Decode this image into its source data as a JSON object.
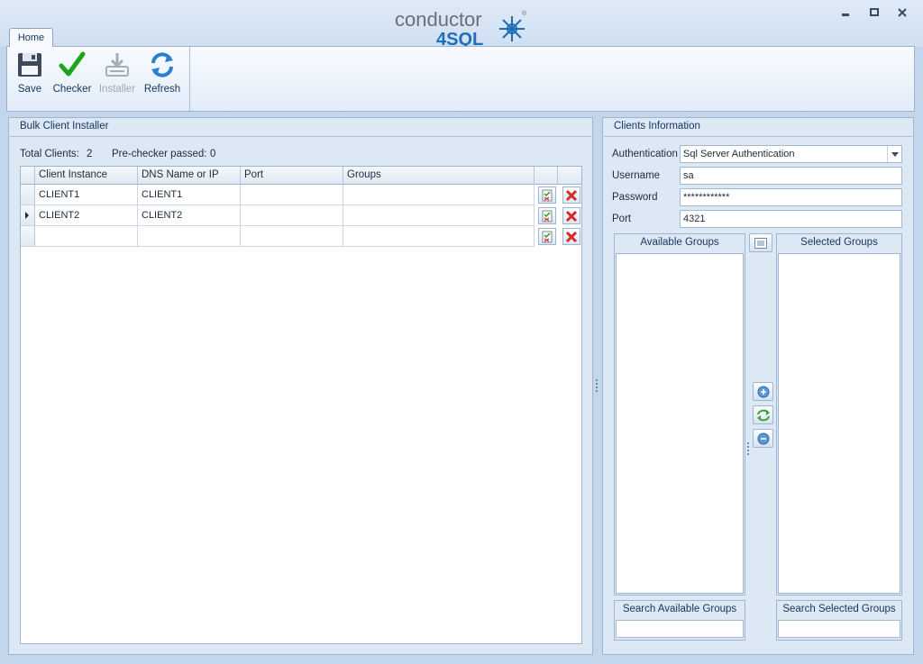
{
  "app": {
    "logo_text_top": "conductor",
    "logo_text_bottom": "4SQL",
    "logo_mark": "®"
  },
  "tabs": [
    {
      "label": "Home"
    }
  ],
  "ribbon": {
    "buttons": [
      {
        "label": "Save",
        "icon": "floppy-disk-icon",
        "enabled": true
      },
      {
        "label": "Checker",
        "icon": "green-check-icon",
        "enabled": true
      },
      {
        "label": "Installer",
        "icon": "install-tray-icon",
        "enabled": false
      },
      {
        "label": "Refresh",
        "icon": "refresh-arrows-icon",
        "enabled": true
      }
    ]
  },
  "bulk": {
    "title": "Bulk Client Installer",
    "total_clients_label": "Total Clients:",
    "total_clients_value": "2",
    "prechecker_label": "Pre-checker passed:",
    "prechecker_value": "0",
    "columns": [
      "Client Instance Name",
      "DNS Name or IP",
      "Port",
      "Groups"
    ],
    "rows": [
      {
        "name": "CLIENT1",
        "dns": "CLIENT1",
        "port": "",
        "groups": ""
      },
      {
        "name": "CLIENT2",
        "dns": "CLIENT2",
        "port": "",
        "groups": ""
      },
      {
        "name": "",
        "dns": "",
        "port": "",
        "groups": ""
      }
    ]
  },
  "clients": {
    "title": "Clients Information",
    "authentication_label": "Authentication",
    "authentication_value": "Sql Server Authentication",
    "username_label": "Username",
    "username_value": "sa",
    "password_label": "Password",
    "password_value": "************",
    "port_label": "Port",
    "port_value": "4321",
    "available_groups_title": "Available Groups",
    "selected_groups_title": "Selected Groups",
    "search_available_title": "Search Available Groups",
    "search_selected_title": "Search Selected Groups",
    "search_available_value": "",
    "search_selected_value": ""
  },
  "colors": {
    "accent": "#15345c",
    "check_green": "#1aa51a",
    "delete_red": "#d42a2a",
    "logo_blue": "#1f6fb8"
  }
}
